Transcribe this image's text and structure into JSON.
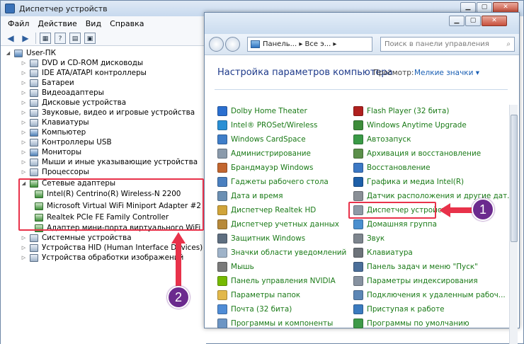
{
  "device_manager": {
    "title": "Диспетчер устройств",
    "menu": [
      "Файл",
      "Действие",
      "Вид",
      "Справка"
    ],
    "root": "User-ПК",
    "nodes": [
      "DVD и CD-ROM дисководы",
      "IDE ATA/ATAPI контроллеры",
      "Батареи",
      "Видеоадаптеры",
      "Дисковые устройства",
      "Звуковые, видео и игровые устройства",
      "Клавиатуры",
      "Компьютер",
      "Контроллеры USB",
      "Мониторы",
      "Мыши и иные указывающие устройства",
      "Процессоры",
      "Сетевые адаптеры"
    ],
    "network_children": [
      "Intel(R) Centrino(R) Wireless-N 2200",
      "Microsoft Virtual WiFi Miniport Adapter #2",
      "Realtek PCIe FE Family Controller",
      "Адаптер мини-порта виртуального WiFi Microso"
    ],
    "nodes_after": [
      "Системные устройства",
      "Устройства HID (Human Interface Devices)",
      "Устройства обработки изображений"
    ]
  },
  "control_panel": {
    "path": "Панель... ▸ Все э... ▸",
    "search_placeholder": "Поиск в панели управления",
    "heading": "Настройка параметров компьютера",
    "view_by_label": "Просмотр:",
    "view_by_value": "Мелкие значки ▾",
    "left_items": [
      "Dolby Home Theater",
      "Intel® PROSet/Wireless",
      "Windows CardSpace",
      "Администрирование",
      "Брандмауэр Windows",
      "Гаджеты рабочего стола",
      "Дата и время",
      "Диспетчер Realtek HD",
      "Диспетчер учетных данных",
      "Защитник Windows",
      "Значки области уведомлений",
      "Мышь",
      "Панель управления NVIDIA",
      "Параметры папок",
      "Почта (32 бита)",
      "Программы и компоненты"
    ],
    "right_items": [
      "Flash Player (32 бита)",
      "Windows Anytime Upgrade",
      "Автозапуск",
      "Архивация и восстановление",
      "Восстановление",
      "Графика и медиа Intel(R)",
      "Датчик расположения и другие дат...",
      "Диспетчер устройств",
      "Домашняя группа",
      "Звук",
      "Клавиатура",
      "Панель задач и меню \"Пуск\"",
      "Параметры индексирования",
      "Подключения к удаленным рабоч...",
      "Приступая к работе",
      "Программы по умолчанию"
    ]
  },
  "annotations": {
    "badge1": "1",
    "badge2": "2"
  },
  "colors": {
    "link": "#1a7a17",
    "highlight": "#e8324a",
    "badge": "#6b2a8e"
  }
}
